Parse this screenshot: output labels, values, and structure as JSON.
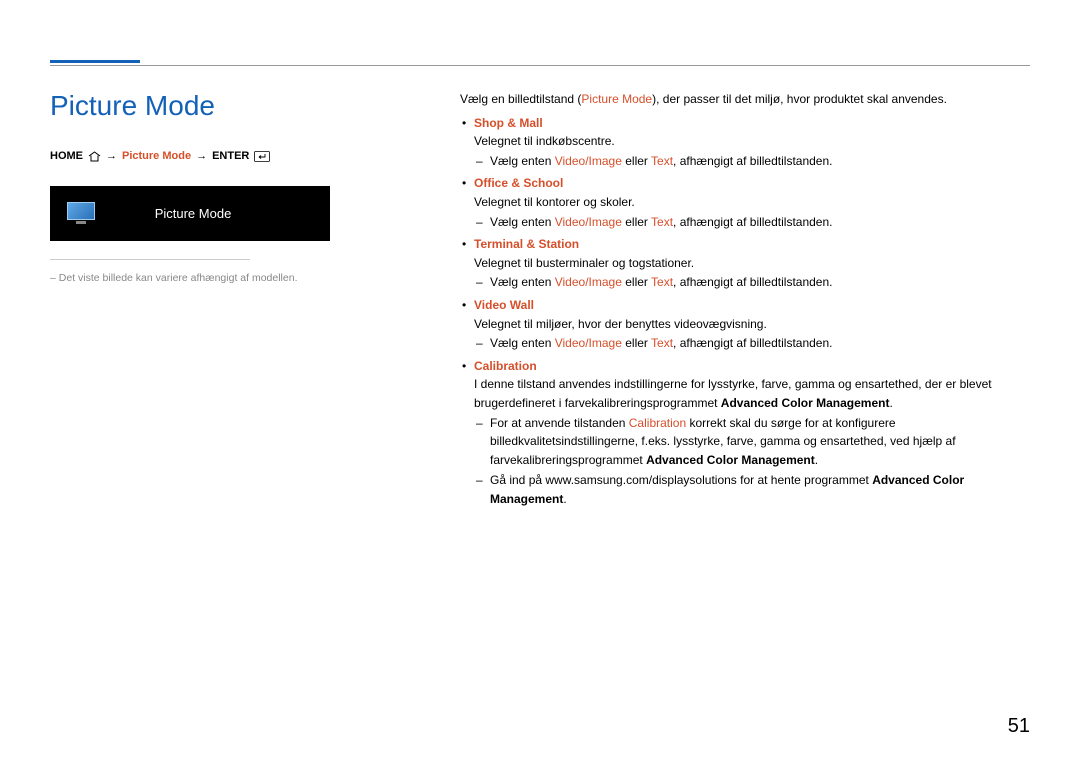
{
  "page_number": "51",
  "title": "Picture Mode",
  "breadcrumb": {
    "home": "HOME",
    "step": "Picture Mode",
    "enter": "ENTER"
  },
  "screenshot_label": "Picture Mode",
  "footnote": "Det viste billede kan variere afhængigt af modellen.",
  "intro": {
    "pre": "Vælg en billedtilstand (",
    "mode": "Picture Mode",
    "post": "), der passer til det miljø, hvor produktet skal anvendes."
  },
  "select_line": {
    "pre": "Vælg enten ",
    "opt1": "Video/Image",
    "mid": " eller ",
    "opt2": "Text",
    "post": ", afhængigt af billedtilstanden."
  },
  "modes": {
    "shop": {
      "name": "Shop & Mall",
      "desc": "Velegnet til indkøbscentre."
    },
    "office": {
      "name": "Office & School",
      "desc": "Velegnet til kontorer og skoler."
    },
    "terminal": {
      "name": "Terminal & Station",
      "desc": "Velegnet til busterminaler og togstationer."
    },
    "videowall": {
      "name": "Video Wall",
      "desc": "Velegnet til miljøer, hvor der benyttes videovægvisning."
    },
    "calibration": {
      "name": "Calibration",
      "desc_pre": "I denne tilstand anvendes indstillingerne for lysstyrke, farve, gamma og ensartethed, der er blevet brugerdefineret i farvekalibreringsprogrammet ",
      "desc_bold": "Advanced Color Management",
      "desc_post": ".",
      "sub1_pre": "For at anvende tilstanden ",
      "sub1_accent": "Calibration",
      "sub1_mid": " korrekt skal du sørge for at konfigurere billedkvalitetsindstillingerne, f.eks. lysstyrke, farve, gamma og ensartethed, ved hjælp af farvekalibreringsprogrammet ",
      "sub1_bold": "Advanced Color Management",
      "sub1_post": ".",
      "sub2_pre": "Gå ind på www.samsung.com/displaysolutions for at hente programmet ",
      "sub2_bold": "Advanced Color Management",
      "sub2_post": "."
    }
  }
}
